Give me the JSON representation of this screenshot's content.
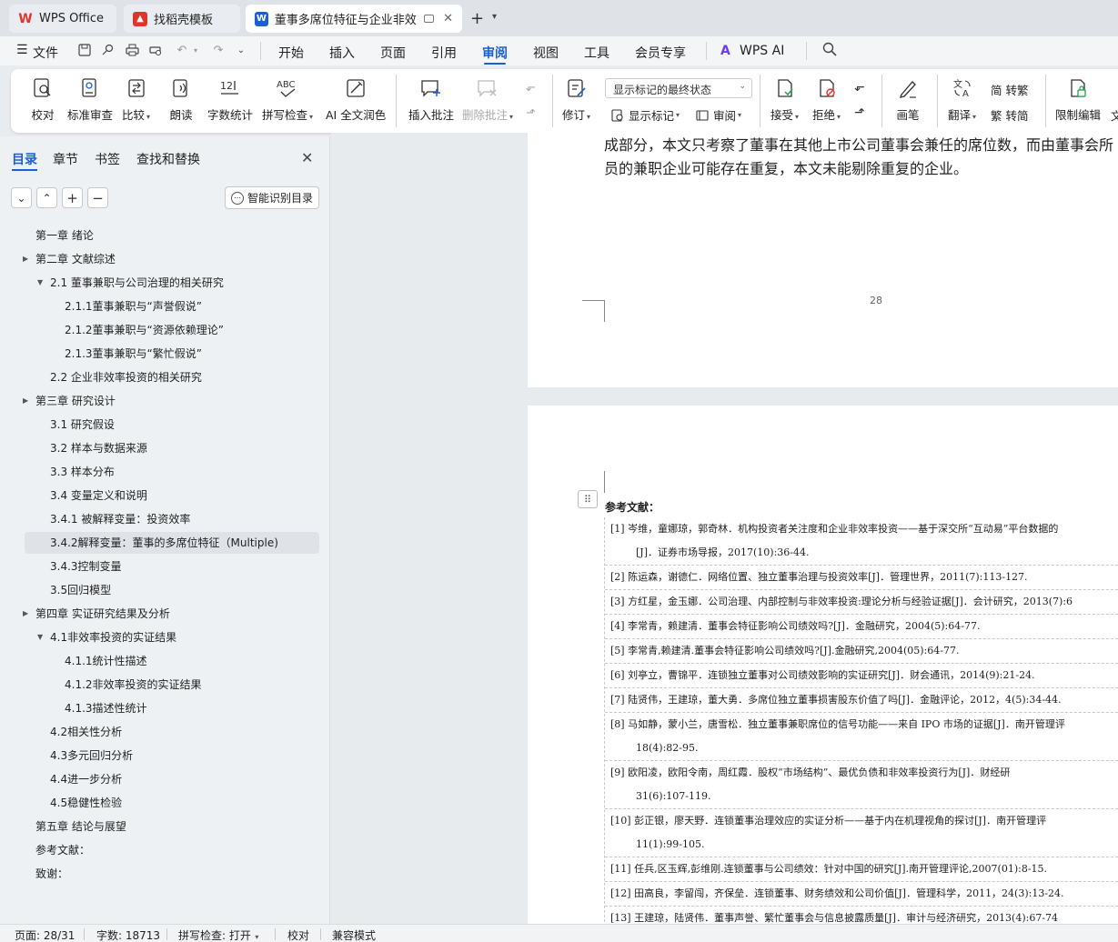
{
  "tabs": [
    {
      "label": "WPS Office",
      "icon": "wps-logo-icon"
    },
    {
      "label": "找稻壳模板",
      "icon": "docer-icon"
    },
    {
      "label": "董事多席位特征与企业非效率",
      "icon": "word-doc-icon",
      "active": true
    }
  ],
  "menubar": {
    "file": "文件",
    "items": [
      "开始",
      "插入",
      "页面",
      "引用",
      "审阅",
      "视图",
      "工具",
      "会员专享"
    ],
    "active": "审阅",
    "wps_ai": "WPS AI"
  },
  "ribbon": {
    "proofread": "校对",
    "standard_review": "标准审查",
    "compare": "比较",
    "read_aloud": "朗读",
    "word_count": "字数统计",
    "spell_check": "拼写检查",
    "ai_polish": "AI 全文润色",
    "insert_comment": "插入批注",
    "delete_comment": "删除批注",
    "track_changes": "修订",
    "markup_select": "显示标记的最终状态",
    "show_markup": "显示标记",
    "review_pane": "审阅",
    "accept": "接受",
    "reject": "拒绝",
    "ink": "画笔",
    "translate": "翻译",
    "to_traditional": "简 转繁",
    "to_simplified": "繁 转简",
    "restrict_edit": "限制编辑",
    "overflow": "文"
  },
  "sidebar": {
    "tabs": [
      "目录",
      "章节",
      "书签",
      "查找和替换"
    ],
    "active_tab": "目录",
    "smart_toc": "智能识别目录",
    "toc": [
      {
        "text": "第一章  绪论",
        "level": 1,
        "arrow": ""
      },
      {
        "text": "第二章  文献综述",
        "level": 1,
        "arrow": "right"
      },
      {
        "text": "2.1  董事兼职与公司治理的相关研究",
        "level": 2,
        "arrow": "down"
      },
      {
        "text": "2.1.1董事兼职与“声誉假说”",
        "level": 3,
        "arrow": ""
      },
      {
        "text": "2.1.2董事兼职与“资源依赖理论”",
        "level": 3,
        "arrow": ""
      },
      {
        "text": "2.1.3董事兼职与“繁忙假说”",
        "level": 3,
        "arrow": ""
      },
      {
        "text": "2.2  企业非效率投资的相关研究",
        "level": 2,
        "arrow": ""
      },
      {
        "text": "第三章  研究设计",
        "level": 1,
        "arrow": "right"
      },
      {
        "text": "3.1  研究假设",
        "level": 2,
        "arrow": ""
      },
      {
        "text": "3.2  样本与数据来源",
        "level": 2,
        "arrow": ""
      },
      {
        "text": "3.3  样本分布",
        "level": 2,
        "arrow": ""
      },
      {
        "text": "3.4  变量定义和说明",
        "level": 2,
        "arrow": ""
      },
      {
        "text": "3.4.1  被解释变量：投资效率",
        "level": 2,
        "arrow": ""
      },
      {
        "text": "3.4.2解释变量：董事的多席位特征（Multiple)",
        "level": 2,
        "arrow": "",
        "selected": true
      },
      {
        "text": "3.4.3控制变量",
        "level": 2,
        "arrow": ""
      },
      {
        "text": "3.5回归模型",
        "level": 2,
        "arrow": ""
      },
      {
        "text": "第四章  实证研究结果及分析",
        "level": 1,
        "arrow": "right"
      },
      {
        "text": "4.1非效率投资的实证结果",
        "level": 2,
        "arrow": "down"
      },
      {
        "text": "4.1.1统计性描述",
        "level": 3,
        "arrow": ""
      },
      {
        "text": "4.1.2非效率投资的实证结果",
        "level": 3,
        "arrow": ""
      },
      {
        "text": "4.1.3描述性统计",
        "level": 3,
        "arrow": ""
      },
      {
        "text": "4.2相关性分析",
        "level": 2,
        "arrow": ""
      },
      {
        "text": "4.3多元回归分析",
        "level": 2,
        "arrow": ""
      },
      {
        "text": "4.4进一步分析",
        "level": 2,
        "arrow": ""
      },
      {
        "text": "4.5稳健性检验",
        "level": 2,
        "arrow": ""
      },
      {
        "text": "第五章  结论与展望",
        "level": 1,
        "arrow": ""
      },
      {
        "text": "参考文献：",
        "level": 1,
        "arrow": ""
      },
      {
        "text": "致谢：",
        "level": 1,
        "arrow": ""
      }
    ]
  },
  "document": {
    "page1_line1": "成部分，本文只考察了董事在其他上市公司董事会兼任的席位数，而由董事会所",
    "page1_line2": "员的兼职企业可能存在重复，本文未能剔除重复的企业。",
    "page_number": "28",
    "ref_title": "参考文献：",
    "references": [
      {
        "l1": "[1]  岑维，童娜琼，郭奇林．机构投资者关注度和企业非效率投资——基于深交所“互动易”平台数据的",
        "l2": "[J]．证券市场导报，2017(10):36-44."
      },
      {
        "l1": "[2]  陈运森，谢德仁．网络位置、独立董事治理与投资效率[J]．管理世界，2011(7):113-127.",
        "l2": ""
      },
      {
        "l1": "[3]  方红星，金玉娜．公司治理、内部控制与非效率投资:理论分析与经验证据[J]．会计研究，2013(7):6",
        "l2": ""
      },
      {
        "l1": "[4]  李常青，赖建清．董事会特征影响公司绩效吗?[J]．金融研究，2004(5):64-77.",
        "l2": ""
      },
      {
        "l1": "[5]  李常青,赖建清.董事会特征影响公司绩效吗?[J].金融研究,2004(05):64-77.",
        "l2": ""
      },
      {
        "l1": "[6]  刘亭立，曹锦平．连锁独立董事对公司绩效影响的实证研究[J]．财会通讯，2014(9):21-24.",
        "l2": ""
      },
      {
        "l1": "[7]  陆贤伟，王建琼，董大勇．多席位独立董事损害股东价值了吗[J]．金融评论，2012，4(5):34-44.",
        "l2": ""
      },
      {
        "l1": "[8]  马如静，蒙小兰，唐雪松．独立董事兼职席位的信号功能——来自 IPO 市场的证据[J]．南开管理评",
        "l2": "18(4):82-95."
      },
      {
        "l1": "[9]  欧阳凌，欧阳令南，周红霞．股权“市场结构”、最优负债和非效率投资行为[J]．财经研",
        "l2": "31(6):107-119."
      },
      {
        "l1": "[10] 彭正银，廖天野．连锁董事治理效应的实证分析——基于内在机理视角的探讨[J]．南开管理评",
        "l2": "11(1):99-105."
      },
      {
        "l1": "[11] 任兵,区玉辉,彭维刚.连锁董事与公司绩效：针对中国的研究[J].南开管理评论,2007(01):8-15.",
        "l2": ""
      },
      {
        "l1": "[12] 田高良，李留闯，齐保垒．连锁董事、财务绩效和公司价值[J]．管理科学，2011，24(3):13-24.",
        "l2": ""
      },
      {
        "l1": "[13] 王建琼，陆贤伟．董事声誉、繁忙董事会与信息披露质量[J]．审计与经济研究，2013(4):67-74",
        "l2": ""
      }
    ]
  },
  "statusbar": {
    "page": "页面: 28/31",
    "words": "字数: 18713",
    "spell": "拼写检查: 打开",
    "proof": "校对",
    "compat": "兼容模式"
  }
}
